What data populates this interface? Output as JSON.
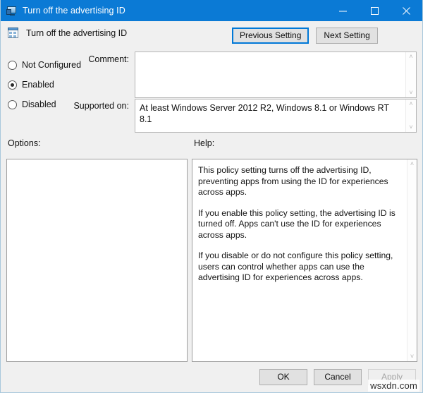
{
  "window": {
    "title": "Turn off the advertising ID",
    "title_icon": "policy-setting-icon",
    "controls": {
      "minimize": "minimize-icon",
      "maximize": "maximize-icon",
      "close": "close-icon"
    }
  },
  "header": {
    "icon": "group-policy-icon",
    "title": "Turn off the advertising ID"
  },
  "nav": {
    "previous_label": "Previous Setting",
    "next_label": "Next Setting",
    "focused": "previous"
  },
  "state": {
    "options": [
      {
        "label": "Not Configured",
        "selected": false
      },
      {
        "label": "Enabled",
        "selected": true
      },
      {
        "label": "Disabled",
        "selected": false
      }
    ]
  },
  "comment": {
    "label": "Comment:",
    "value": "",
    "placeholder": ""
  },
  "supported_on": {
    "label": "Supported on:",
    "value": "At least Windows Server 2012 R2, Windows 8.1 or Windows RT 8.1"
  },
  "columns": {
    "options_label": "Options:",
    "help_label": "Help:"
  },
  "options_panel": {
    "content": ""
  },
  "help_panel": {
    "paragraphs": [
      "This policy setting turns off the advertising ID, preventing apps from using the ID for experiences across apps.",
      "If you enable this policy setting, the advertising ID is turned off. Apps can't use the ID for experiences across apps.",
      "If you disable or do not configure this policy setting, users can control whether apps can use the advertising ID for experiences across apps."
    ]
  },
  "footer": {
    "ok_label": "OK",
    "cancel_label": "Cancel",
    "apply_label": "Apply",
    "apply_disabled": true
  },
  "watermark": {
    "text": "wsxdn.com"
  },
  "scrollbar": {
    "up_arrow": "˄",
    "down_arrow": "˅"
  },
  "colors": {
    "titlebar": "#0b7ad5",
    "window_background": "#f0f0f0",
    "accent_focus": "#0078d7",
    "field_background": "#ffffff",
    "border": "#a8c8dc"
  }
}
